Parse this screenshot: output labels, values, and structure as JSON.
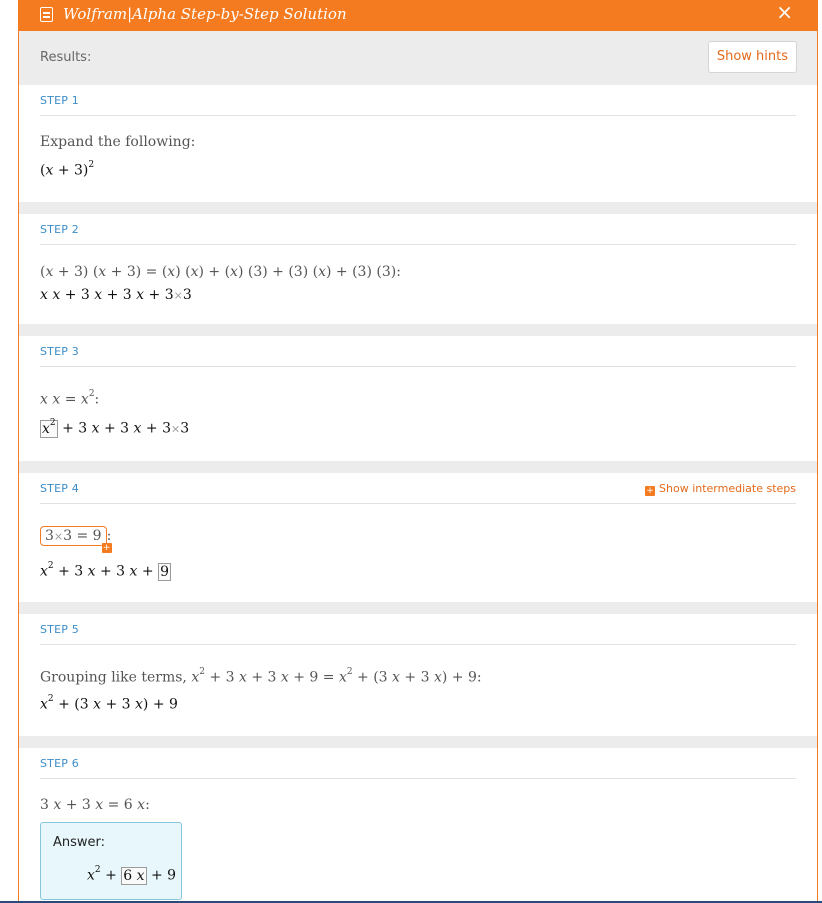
{
  "window": {
    "title": "Wolfram|Alpha Step-by-Step Solution",
    "close_symbol": "×",
    "logo_icon": "notebook-icon"
  },
  "results": {
    "label": "Results:",
    "show_hints": "Show hints"
  },
  "steps": [
    {
      "label": "STEP 1",
      "description": "Expand the following:",
      "expression": "(x + 3)²"
    },
    {
      "label": "STEP 2",
      "description": "(x + 3) (x + 3) = (x) (x) + (x) (3) + (3) (x) + (3) (3):",
      "expression": "x x + 3 x + 3 x + 3×3"
    },
    {
      "label": "STEP 3",
      "description": "x x = x²:",
      "expression": "x² + 3 x + 3 x + 3×3"
    },
    {
      "label": "STEP 4",
      "intermediate_link": "Show intermediate steps",
      "description": "3×3 = 9:",
      "expression": "x² + 3 x + 3 x + 9"
    },
    {
      "label": "STEP 5",
      "description": "Grouping like terms, x² + 3 x + 3 x + 9 = x² + (3 x + 3 x) + 9:",
      "expression": "x² + (3 x + 3 x) + 9"
    },
    {
      "label": "STEP 6",
      "description": "3 x + 3 x = 6 x:",
      "answer_label": "Answer:",
      "answer": "x² + 6 x + 9"
    }
  ],
  "colors": {
    "accent": "#f47b20",
    "step_label": "#3c8dc8",
    "answer_bg": "#e8f7fb",
    "answer_border": "#86c7dc",
    "separator": "#ececec"
  }
}
